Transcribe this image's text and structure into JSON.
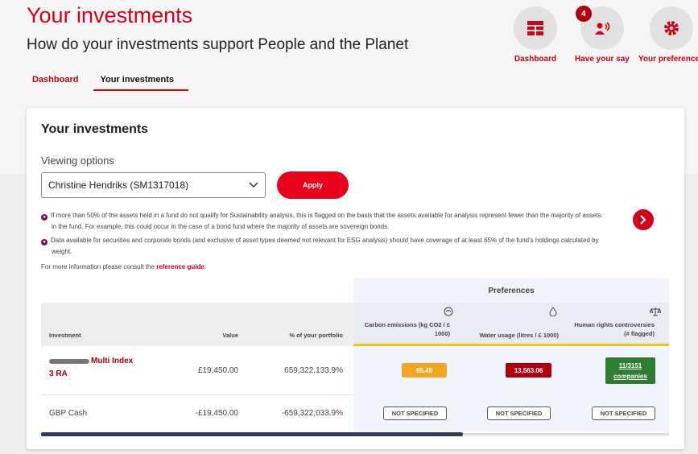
{
  "header": {
    "title": "Your investments",
    "subtitle": "How do your investments support People and the Planet"
  },
  "nav": {
    "tabs": [
      {
        "label": "Dashboard"
      },
      {
        "label": "Your investments"
      }
    ]
  },
  "quick_actions": [
    {
      "label": "Dashboard",
      "icon": "dashboard-icon"
    },
    {
      "label": "Have your say",
      "icon": "feedback-icon",
      "badge": "4"
    },
    {
      "label": "Your preferences",
      "icon": "gear-icon"
    }
  ],
  "card": {
    "title": "Your investments",
    "viewing_label": "Viewing options",
    "select_value": "Christine Hendriks (SM1317018)",
    "apply_label": "Apply",
    "note1_a": "If more than 50% of the assets held in a fund do not qualify for Sustainability analysis, this is flagged on the basis that the assets available for analysis represent fewer than the majority of assets",
    "note1_b": "in the fund. For example, this could occur in the case of a bond fund where the majority of assets are sovereign bonds.",
    "note2_a": "Data available for securities and corporate bonds (and exclusive of asset types deemed not relevant for ESG analysis) should have coverage of at least 65% of the fund's holdings calculated by",
    "note2_b": "weight.",
    "more_info": "For more information please consult the",
    "ref_link": "reference guide",
    "ref_tail": "."
  },
  "table": {
    "preferences_header": "Preferences",
    "columns": {
      "investment": "Investment",
      "value": "Value",
      "pct": "% of your portfolio",
      "carbon": "Carbon emissions (kg CO2 / £ 1000)",
      "water": "Water usage (litres / £ 1000)",
      "human": "Human rights controversies (# flagged)"
    },
    "rows": [
      {
        "name": "Multi Index 3 RA",
        "value": "£19,450.00",
        "pct": "659,322,133.9%",
        "carbon": "95.49",
        "water": "13,563.06",
        "human": "11/3151 companies"
      },
      {
        "name": "GBP Cash",
        "value": "-£19,450.00",
        "pct": "-659,322,033.9%",
        "carbon": "NOT SPECIFIED",
        "water": "NOT SPECIFIED",
        "human": "NOT SPECIFIED"
      }
    ]
  },
  "colors": {
    "brand": "#d0021b",
    "amber": "#f5a623",
    "dark_red": "#b0000f",
    "green": "#2e7d32",
    "highlight": "#f0c419"
  }
}
